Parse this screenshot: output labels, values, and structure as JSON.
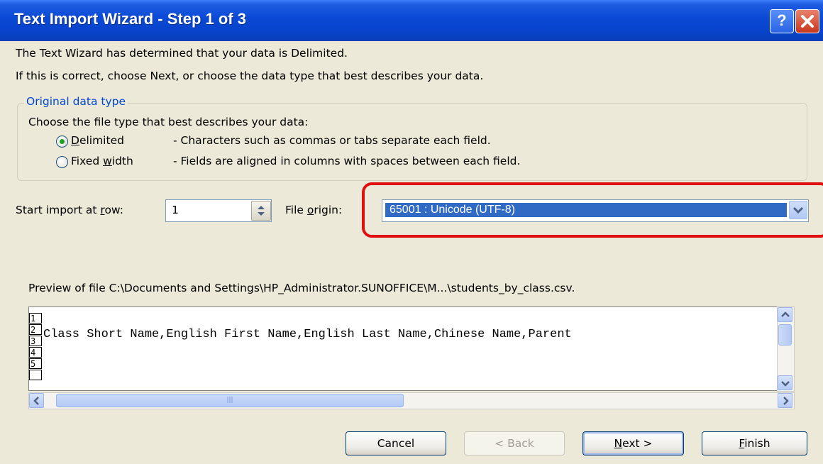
{
  "window": {
    "title": "Text Import Wizard - Step 1 of 3"
  },
  "intro": {
    "line1": "The Text Wizard has determined that your data is Delimited.",
    "line2": "If this is correct, choose Next, or choose the data type that best describes your data."
  },
  "original_data_type": {
    "legend": "Original data type",
    "prompt": "Choose the file type that best describes your data:",
    "options": [
      {
        "label_pre": "",
        "label_key": "D",
        "label_post": "elimited",
        "description": "- Characters such as commas or tabs separate each field.",
        "selected": true
      },
      {
        "label_pre": "Fixed ",
        "label_key": "w",
        "label_post": "idth",
        "description": "- Fields are aligned in columns with spaces between each field.",
        "selected": false
      }
    ]
  },
  "start_row": {
    "label_pre": "Start import at ",
    "label_key": "r",
    "label_post": "ow:",
    "value": "1"
  },
  "file_origin": {
    "label_pre": "File ",
    "label_key": "o",
    "label_post": "rigin:",
    "value": "65001 : Unicode (UTF-8)"
  },
  "preview": {
    "label": "Preview of file C:\\Documents and Settings\\HP_Administrator.SUNOFFICE\\M...\\students_by_class.csv.",
    "rows": [
      {
        "num": "1",
        "text": ""
      },
      {
        "num": "2",
        "text": "Class Short Name,English First Name,English Last Name,Chinese Name,Parent"
      },
      {
        "num": "3",
        "text": ""
      },
      {
        "num": "4",
        "text": ""
      },
      {
        "num": "5",
        "text": ""
      }
    ]
  },
  "buttons": {
    "cancel": "Cancel",
    "back": "< Back",
    "next_key": "N",
    "next_rest": "ext >",
    "finish_key": "F",
    "finish_rest": "inish"
  },
  "colors": {
    "title_bar": "#0a49d6",
    "highlight": "#316ac5",
    "annotation": "#e01010",
    "radio_dot": "#21a121"
  }
}
